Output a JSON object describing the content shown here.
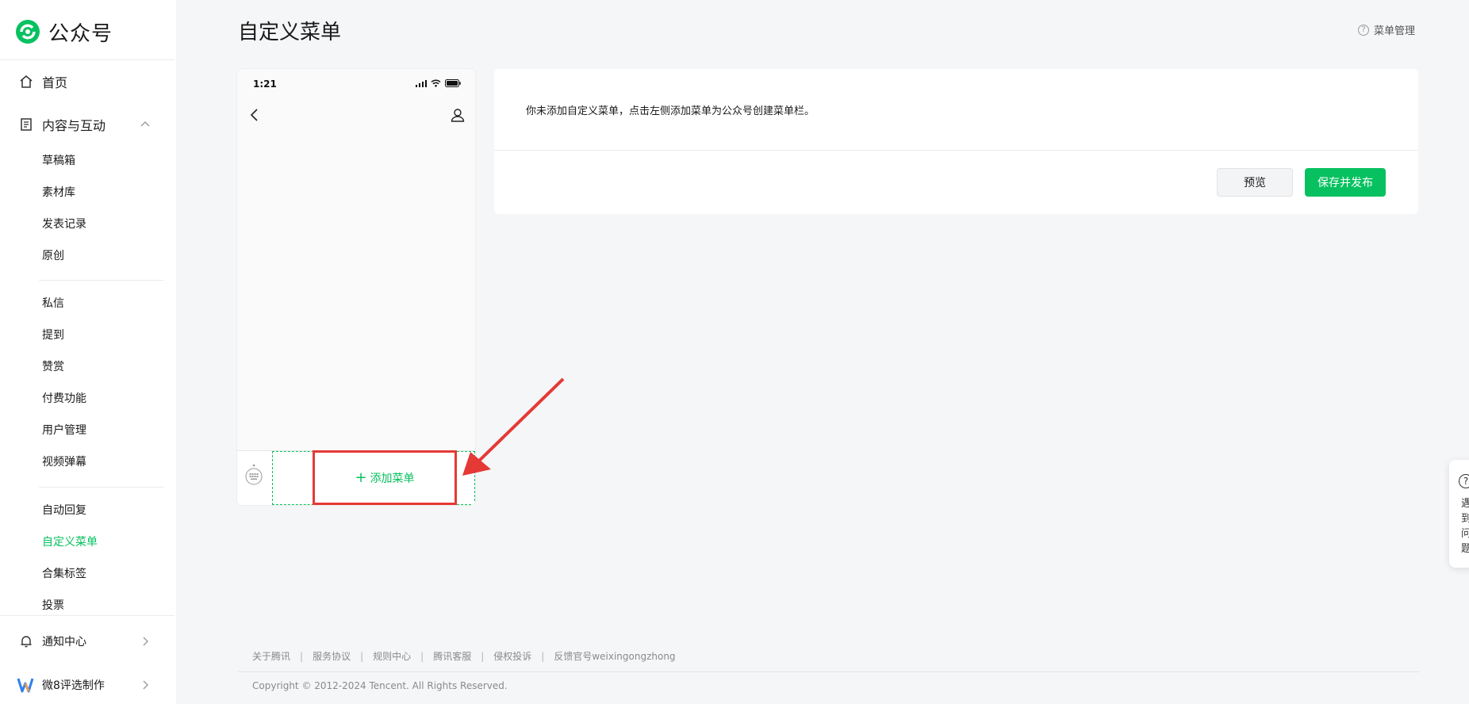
{
  "brand": {
    "name": "公众号",
    "accent": "#07c160"
  },
  "sidebar": {
    "home": {
      "label": "首页",
      "icon": "home-icon"
    },
    "content": {
      "label": "内容与互动",
      "icon": "document-icon"
    },
    "group1": [
      "草稿箱",
      "素材库",
      "发表记录",
      "原创"
    ],
    "group2": [
      "私信",
      "提到",
      "赞赏",
      "付费功能",
      "用户管理",
      "视频弹幕"
    ],
    "group3": [
      "自动回复",
      "自定义菜单",
      "合集标签",
      "投票"
    ],
    "active_item": "自定义菜单",
    "notify": {
      "label": "通知中心",
      "icon": "bell-icon"
    },
    "app": {
      "label": "微8评选制作",
      "icon": "app-logo-icon"
    }
  },
  "page": {
    "title": "自定义菜单",
    "help_label": "菜单管理"
  },
  "phone": {
    "time": "1:21",
    "add_menu_label": "添加菜单"
  },
  "info": {
    "message": "你未添加自定义菜单，点击左侧添加菜单为公众号创建菜单栏。",
    "preview_label": "预览",
    "publish_label": "保存并发布"
  },
  "footer": {
    "links": [
      "关于腾讯",
      "服务协议",
      "规则中心",
      "腾讯客服",
      "侵权投诉",
      "反馈官号weixingongzhong"
    ],
    "copyright": "Copyright © 2012-2024 Tencent. All Rights Reserved."
  },
  "float_help": {
    "text": "遇到问题"
  },
  "colors": {
    "annotation": "#e53935",
    "accent": "#07c160"
  }
}
